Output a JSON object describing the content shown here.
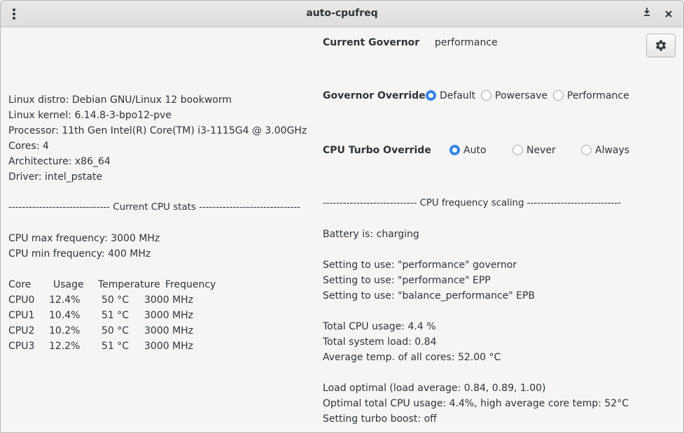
{
  "window": {
    "title": "auto-cpufreq"
  },
  "icons": {
    "menu": "vertical-dots-icon",
    "download": "download-icon",
    "close": "close-icon",
    "settings": "gear-icon"
  },
  "system": {
    "distro": "Linux distro: Debian GNU/Linux 12 bookworm",
    "kernel": "Linux kernel: 6.14.8-3-bpo12-pve",
    "processor": "Processor: 11th Gen Intel(R) Core(TM) i3-1115G4 @ 3.00GHz",
    "cores": "Cores: 4",
    "architecture": "Architecture: x86_64",
    "driver": "Driver: intel_pstate"
  },
  "cpu_stats": {
    "header": "------------------------------ Current CPU stats ------------------------------",
    "max_freq": "CPU max frequency: 3000 MHz",
    "min_freq": "CPU min frequency: 400 MHz",
    "columns": [
      "Core",
      "Usage",
      "Temperature",
      "Frequency"
    ],
    "rows": [
      [
        "CPU0",
        "12.4%",
        "50 °C",
        "3000 MHz"
      ],
      [
        "CPU1",
        "10.4%",
        "51 °C",
        "3000 MHz"
      ],
      [
        "CPU2",
        "10.2%",
        "50 °C",
        "3000 MHz"
      ],
      [
        "CPU3",
        "12.2%",
        "51 °C",
        "3000 MHz"
      ]
    ]
  },
  "governor": {
    "label": "Current Governor",
    "value": "performance",
    "override_label": "Governor Override",
    "options": [
      "Default",
      "Powersave",
      "Performance"
    ],
    "selected": 0
  },
  "turbo": {
    "label": "CPU Turbo Override",
    "options": [
      "Auto",
      "Never",
      "Always"
    ],
    "selected": 0
  },
  "scaling": {
    "header": "---------------------------- CPU frequency scaling ----------------------------",
    "battery": "Battery is: charging",
    "gov": "Setting to use: \"performance\" governor",
    "epp": "Setting to use: \"performance\" EPP",
    "epb": "Setting to use: \"balance_performance\" EPB",
    "usage": "Total CPU usage: 4.4 %",
    "load": "Total system load: 0.84",
    "temp": "Average temp. of all cores: 52.00 °C",
    "load_optimal": "Load optimal (load average: 0.84, 0.89, 1.00)",
    "optimal_usage": "Optimal total CPU usage: 4.4%, high average core temp: 52°C",
    "turbo": "Setting turbo boost: off"
  }
}
